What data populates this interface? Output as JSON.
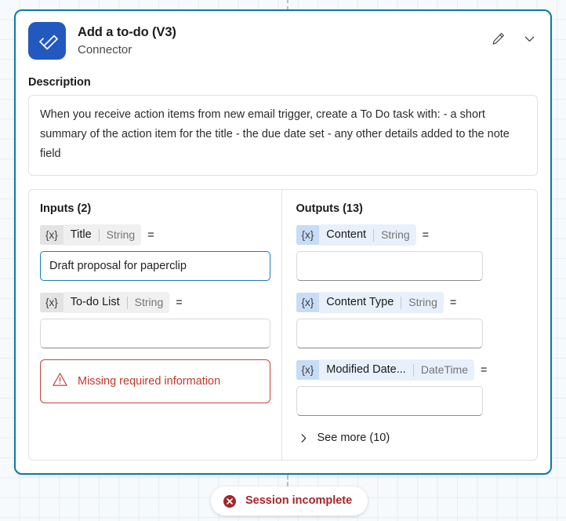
{
  "canvas": {
    "connector_line_style": "dashed",
    "connector_color": "#b9bec3",
    "grid_color": "#e4eef3",
    "background_color": "#f7fafc"
  },
  "card": {
    "border_color": "#0e7aa8",
    "icon_background": "#2159be",
    "icon_name": "todo-checkmark-icon",
    "title": "Add a to-do (V3)",
    "subtitle": "Connector",
    "actions": [
      {
        "name": "edit-button",
        "icon": "pencil-icon"
      },
      {
        "name": "collapse-button",
        "icon": "chevron-down-icon"
      }
    ]
  },
  "description": {
    "label": "Description",
    "text": "When you receive action items from new email trigger, create a To Do task with: - a short summary of the action item for the title - the due date set - any other details added to the note field"
  },
  "inputs": {
    "heading": "Inputs (2)",
    "equals_symbol": "=",
    "token_symbol": "{x}",
    "items": [
      {
        "name": "Title",
        "type": "String",
        "value": "Draft proposal for paperclip",
        "placeholder": "",
        "filled": true
      },
      {
        "name": "To-do List",
        "type": "String",
        "value": "",
        "placeholder": "",
        "filled": false
      }
    ],
    "warning": {
      "icon": "warning-triangle-icon",
      "text": "Missing required information",
      "color": "#c0392b",
      "border_color": "#c94040"
    }
  },
  "outputs": {
    "heading": "Outputs (13)",
    "equals_symbol": "=",
    "token_symbol": "{x}",
    "items": [
      {
        "name": "Content",
        "type": "String",
        "value": "",
        "placeholder": ""
      },
      {
        "name": "Content Type",
        "type": "String",
        "value": "",
        "placeholder": ""
      },
      {
        "name": "Modified Date...",
        "type": "DateTime",
        "value": "",
        "placeholder": ""
      }
    ],
    "see_more": {
      "label": "See more (10)",
      "icon": "chevron-right-icon"
    }
  },
  "status": {
    "label": "Session incomplete",
    "icon": "error-circle-x-icon",
    "color": "#a4262c"
  }
}
